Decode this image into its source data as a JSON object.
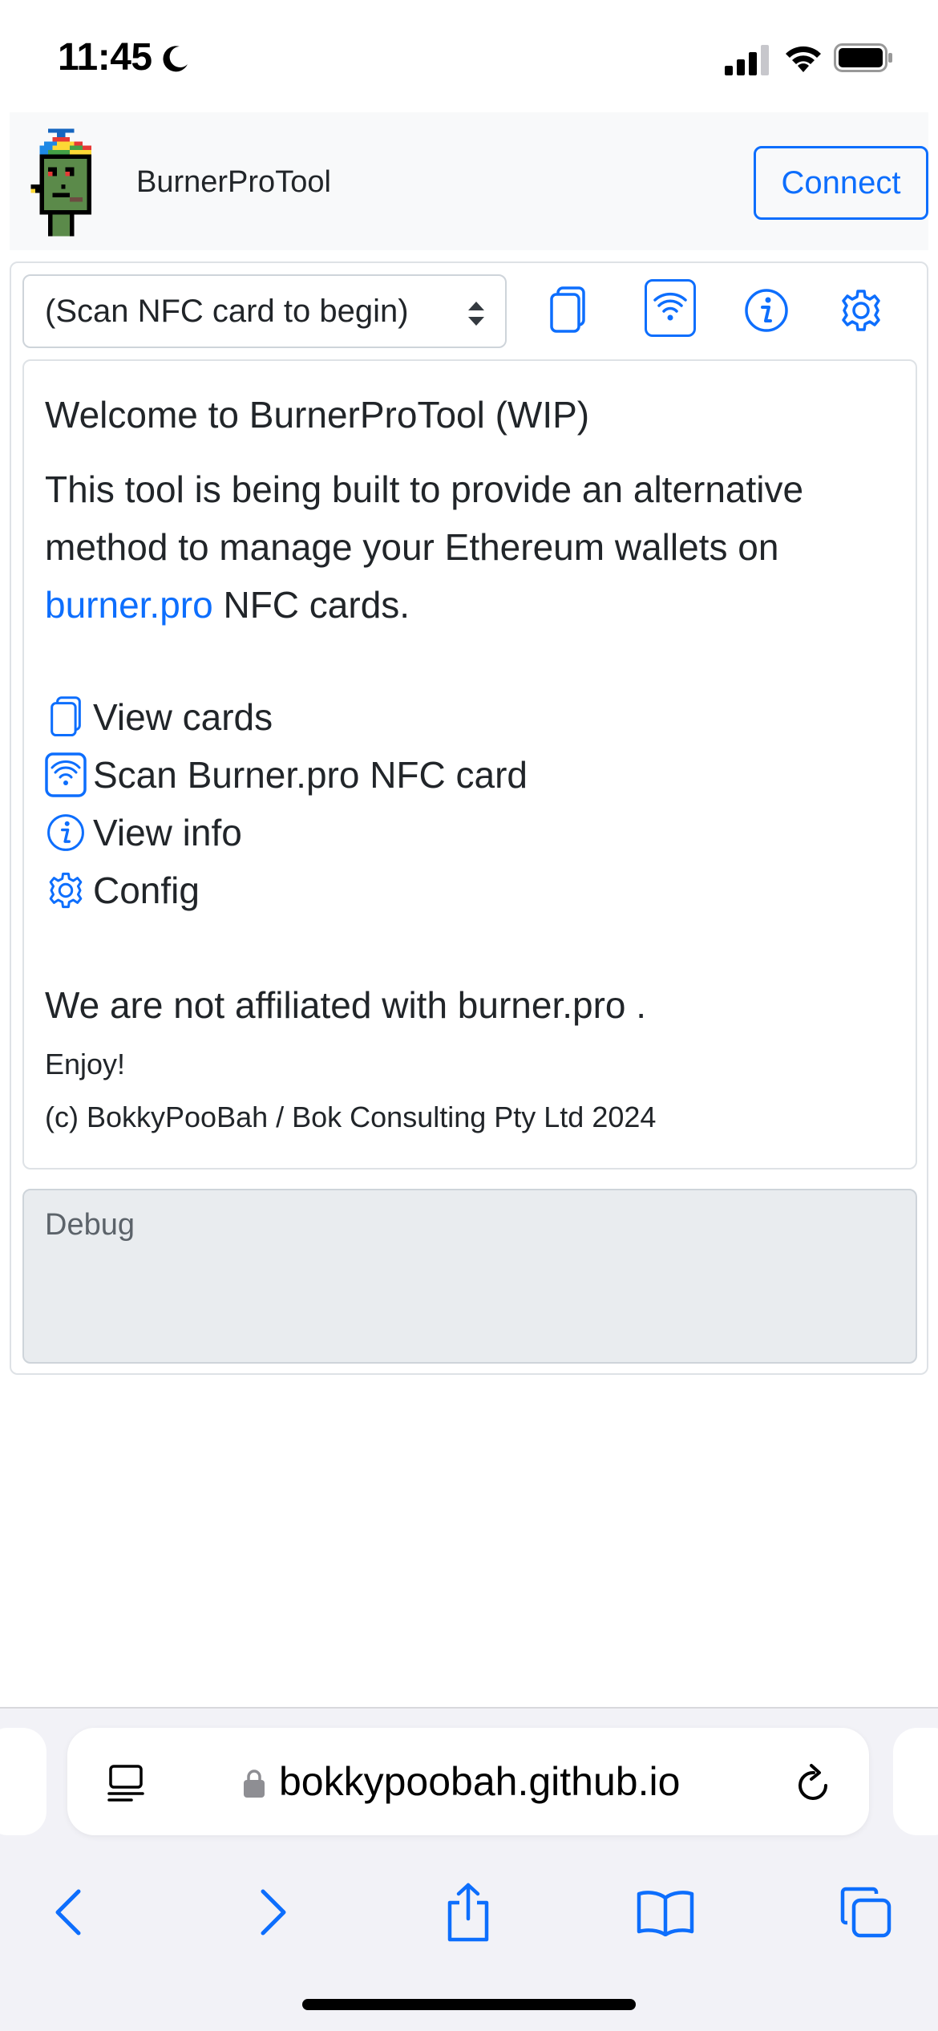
{
  "status_bar": {
    "time": "11:45",
    "icons": [
      "moon-icon",
      "signal-icon",
      "wifi-icon",
      "battery-icon"
    ]
  },
  "navbar": {
    "brand": "BurnerProTool",
    "connect_label": "Connect"
  },
  "toolbar": {
    "select_value": "(Scan NFC card to begin)",
    "icons": [
      "cards-icon",
      "scan-nfc-icon",
      "info-icon",
      "gear-icon"
    ]
  },
  "welcome": {
    "title": "Welcome to BurnerProTool (WIP)",
    "intro_before_link": "This tool is being built to provide an alternative method to manage your Ethereum wallets on ",
    "link_text": "burner.pro",
    "intro_after_link": " NFC cards.",
    "features": [
      {
        "icon": "cards-icon",
        "label": "View cards"
      },
      {
        "icon": "scan-nfc-icon",
        "label": "Scan Burner.pro NFC card"
      },
      {
        "icon": "info-icon",
        "label": "View info"
      },
      {
        "icon": "gear-icon",
        "label": "Config"
      }
    ],
    "disclaimer": "We are not affiliated with burner.pro .",
    "enjoy": "Enjoy!",
    "copyright": "(c) BokkyPooBah / Bok Consulting Pty Ltd 2024"
  },
  "debug": {
    "placeholder": "Debug"
  },
  "browser": {
    "url": "bokkypoobah.github.io",
    "nav": [
      "back-icon",
      "forward-icon",
      "share-icon",
      "bookmarks-icon",
      "tabs-icon"
    ]
  },
  "colors": {
    "accent": "#0d6efd",
    "navbar_bg": "#f8f9fa",
    "debug_bg": "#e9ecef"
  }
}
